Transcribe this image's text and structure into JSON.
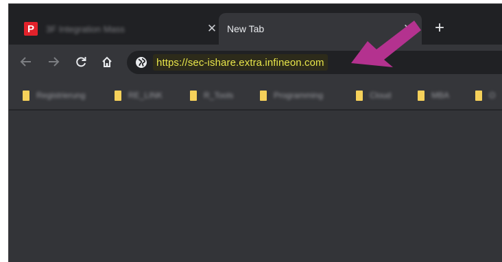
{
  "tabs": [
    {
      "title": "3F Integration Mass",
      "favicon_letter": "P",
      "active": false
    },
    {
      "title": "New Tab",
      "active": true
    }
  ],
  "toolbar": {
    "url": "https://sec-ishare.extra.infineon.com"
  },
  "bookmarks": [
    {
      "label": "Registrierung"
    },
    {
      "label": "RE_LINK"
    },
    {
      "label": "R_Tools"
    },
    {
      "label": "Programming"
    },
    {
      "label": "Cloud"
    },
    {
      "label": "MBA"
    },
    {
      "label": "O"
    }
  ],
  "icons": {
    "close": "close-icon",
    "new_tab": "plus-icon",
    "back": "arrow-left-icon",
    "forward": "arrow-right-icon",
    "reload": "reload-icon",
    "home": "home-icon",
    "site": "globe-icon",
    "folder": "folder-icon",
    "annotation": "pointer-arrow-icon"
  },
  "colors": {
    "chrome_dark": "#202124",
    "toolbar": "#35363a",
    "content": "#333438",
    "url_text": "#e9e64a",
    "favicon_red": "#e2222b",
    "folder_yellow": "#f6d15a",
    "annotation_magenta": "#b4328f"
  }
}
